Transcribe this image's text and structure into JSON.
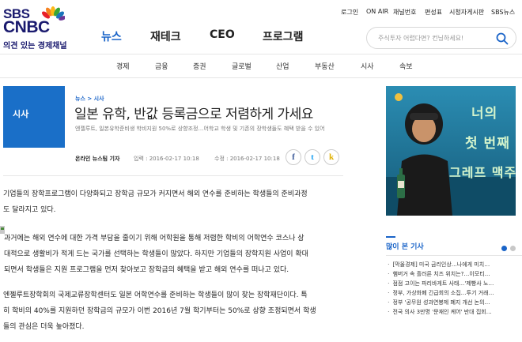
{
  "logo": {
    "line1": "SBS",
    "line2": "CNBC",
    "tagline": "의견 있는 경제채널"
  },
  "top_links": [
    "로그인",
    "ON AIR",
    "채널번호",
    "편성표",
    "시청자게시판",
    "SBS뉴스"
  ],
  "main_nav": [
    "뉴스",
    "재테크",
    "CEO",
    "프로그램"
  ],
  "search": {
    "placeholder": "주식투자 어렵다면? 컨닝하세요!"
  },
  "sub_nav": [
    "경제",
    "금융",
    "증권",
    "글로벌",
    "산업",
    "부동산",
    "시사",
    "속보"
  ],
  "article": {
    "section": "시사",
    "breadcrumb": [
      "뉴스",
      "시사"
    ],
    "breadcrumb_sep": ">",
    "title": "일본 유학, 반값 등록금으로 저렴하게 가세요",
    "subtitle": "엔젤루트, 일본유학준비생 학비지원 50%로 상향조정…어학교 학생 및 기존의 장학생들도 혜택 받을 수 있어",
    "reporter": "온라인 뉴스팀 기자",
    "input_label": "입력 : 2016-02-17 10:18",
    "modified_label": "수정 : 2016-02-17 10:18",
    "share": [
      "f",
      "t",
      "k"
    ],
    "paragraphs": [
      [
        "기업들의 장학프로그램이 다양화되고 장학금 규모가 커지면서 해외 연수를 준비하는 학생들의 준비과정",
        "도 달라지고 있다."
      ],
      [
        "과거에는 해외 연수에 대한 가격 부담을 줄이기 위해 어학원을 통해 저렴한 학비의 어학연수 코스나 상",
        "대적으로 생활비가 적게 드는 국가를 선택하는 학생들이 많았다. 하지만 기업들의 장학지원 사업이 확대",
        "되면서 학생들은 지원 프로그램을 먼저 찾아보고 장학금의 혜택을 받고 해외 연수를 떠나고 있다."
      ],
      [
        "엔젤루트장학회의 국제교류장학센터도 일본 어학연수를 준비하는 학생들이 많이 찾는 장학재단이다. 특",
        "히 학비의 40%를 지원하던 장학금의 규모가 이번 2016년 7월 학기부터는 50%로 상향 조정되면서 학생",
        "들의 관심은 더욱 높아졌다."
      ]
    ]
  },
  "ad": {
    "text_line1": "너의",
    "text_line2": "첫 번째",
    "text_line3": "그레프 맥주"
  },
  "popular": {
    "title": "많이 본 기사",
    "items": [
      "[막올경제] 미국 금리인상…나에게 미치…",
      "햄버거 속 흘러른 치즈 위치는?…이모티…",
      "점점 고이는 파리바게트 사태…'제빵사 노…",
      "정부, 가상화폐 긴급회의 소집…투기 거래…",
      "정부 '공무원 성과연봉제 폐지 개선 논의…",
      "전국 의사 3만명 '문재인 케어' 반대 집회…"
    ],
    "bullet": "ㆍ"
  },
  "colors": {
    "accent": "#1a64c8",
    "section_box": "#1a6fc8"
  }
}
